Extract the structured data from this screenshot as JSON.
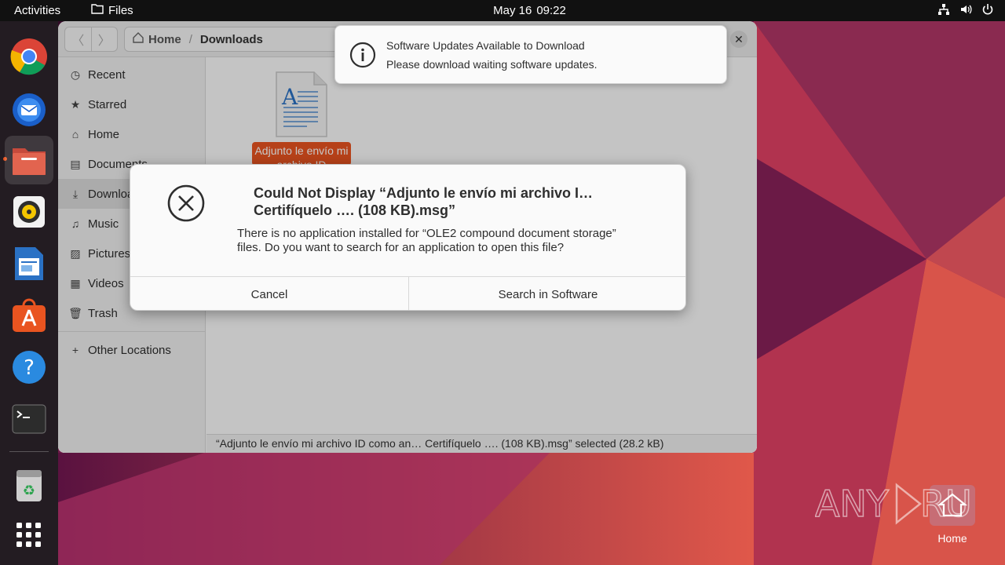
{
  "topbar": {
    "activities": "Activities",
    "app_name": "Files",
    "date": "May 16",
    "time": "09:22",
    "tray_icons": [
      "network-icon",
      "volume-icon",
      "power-icon"
    ]
  },
  "dock": {
    "items": [
      "chrome",
      "thunderbird",
      "files",
      "rhythmbox",
      "libreoffice-writer",
      "app-center",
      "help",
      "terminal",
      "trash",
      "show-apps"
    ]
  },
  "window": {
    "breadcrumb": {
      "home": "Home",
      "current": "Downloads"
    },
    "sidebar": [
      {
        "label": "Recent",
        "icon": "clock-icon"
      },
      {
        "label": "Starred",
        "icon": "star-icon"
      },
      {
        "label": "Home",
        "icon": "home-icon"
      },
      {
        "label": "Documents",
        "icon": "document-icon"
      },
      {
        "label": "Downloads",
        "icon": "download-icon"
      },
      {
        "label": "Music",
        "icon": "music-icon"
      },
      {
        "label": "Pictures",
        "icon": "picture-icon"
      },
      {
        "label": "Videos",
        "icon": "video-icon"
      },
      {
        "label": "Trash",
        "icon": "trash-icon"
      },
      {
        "label": "Other Locations",
        "icon": "plus-icon"
      }
    ],
    "file": {
      "name": "Adjunto le envío mi archivo ID"
    },
    "status": "“Adjunto le envío mi archivo ID como an… Certifíquelo …. (108 KB).msg” selected (28.2 kB)"
  },
  "notification": {
    "title": "Software Updates Available to Download",
    "body": "Please download waiting software updates."
  },
  "dialog": {
    "title_line1": "Could Not Display “Adjunto le envío mi archivo I…",
    "title_line2": "Certifíquelo …. (108 KB).msg”",
    "body_line1": "There is no application installed for “OLE2 compound document storage”",
    "body_line2": "files. Do you want to search for an application to open this file?",
    "cancel": "Cancel",
    "search": "Search in Software"
  },
  "desktop": {
    "home_label": "Home",
    "watermark": "ANY RUN"
  },
  "colors": {
    "accent": "#e95420",
    "topbar": "#111111",
    "dock": "#231c22"
  }
}
